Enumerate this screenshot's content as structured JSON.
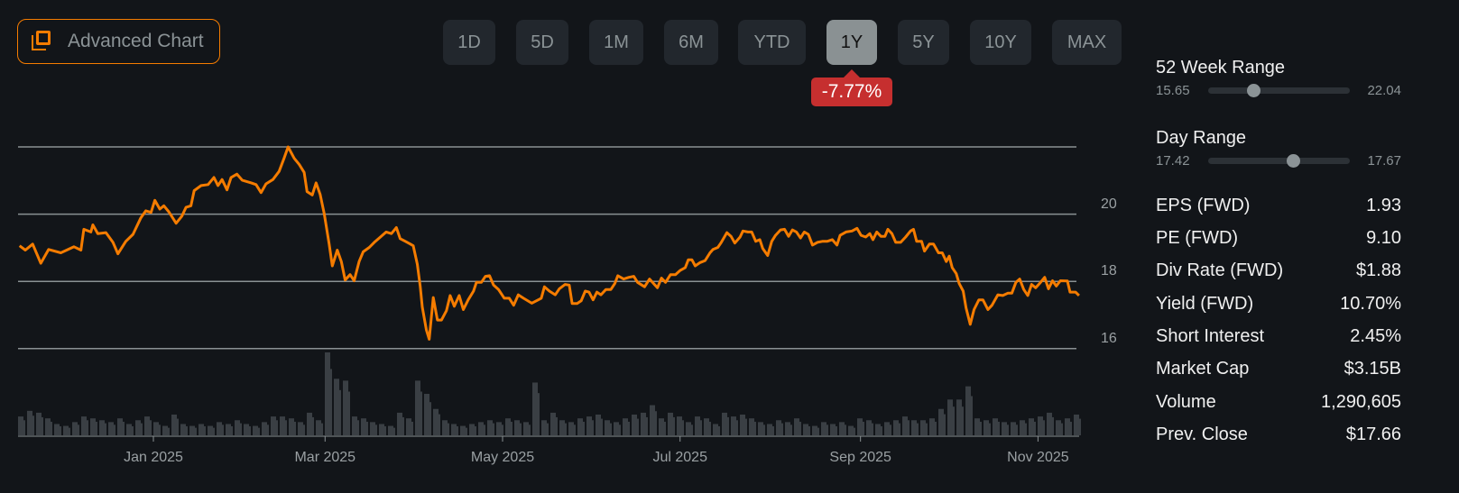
{
  "header": {
    "advanced_chart_label": "Advanced Chart"
  },
  "ranges": [
    {
      "label": "1D",
      "active": false
    },
    {
      "label": "5D",
      "active": false
    },
    {
      "label": "1M",
      "active": false
    },
    {
      "label": "6M",
      "active": false
    },
    {
      "label": "YTD",
      "active": false
    },
    {
      "label": "1Y",
      "active": true
    },
    {
      "label": "5Y",
      "active": false
    },
    {
      "label": "10Y",
      "active": false
    },
    {
      "label": "MAX",
      "active": false
    }
  ],
  "change_badge": "-7.77%",
  "colors": {
    "accent": "#f57c00",
    "negative": "#c62f2f",
    "volume": "#3a3f44",
    "grid": "#8a9193"
  },
  "week52": {
    "title": "52 Week Range",
    "low": "15.65",
    "high": "22.04",
    "position": 0.32
  },
  "day_range": {
    "title": "Day Range",
    "low": "17.42",
    "high": "17.67",
    "position": 0.6
  },
  "stats": [
    {
      "label": "EPS (FWD)",
      "value": "1.93"
    },
    {
      "label": "PE (FWD)",
      "value": "9.10"
    },
    {
      "label": "Div Rate (FWD)",
      "value": "$1.88"
    },
    {
      "label": "Yield (FWD)",
      "value": "10.70%"
    },
    {
      "label": "Short Interest",
      "value": "2.45%"
    },
    {
      "label": "Market Cap",
      "value": "$3.15B"
    },
    {
      "label": "Volume",
      "value": "1,290,605"
    },
    {
      "label": "Prev. Close",
      "value": "$17.66"
    }
  ],
  "chart_data": {
    "type": "line",
    "x_unit": "days since 2025-01-01",
    "y_ticks": [
      {
        "value": 20,
        "label": "20"
      },
      {
        "value": 18,
        "label": "18"
      },
      {
        "value": 16,
        "label": "16"
      }
    ],
    "y_gridlines": [
      16,
      18,
      20,
      22
    ],
    "ylim": [
      16,
      22
    ],
    "x_ticks": [
      {
        "day": 0,
        "label": "Jan 2025"
      },
      {
        "day": 59,
        "label": "Mar 2025"
      },
      {
        "day": 120,
        "label": "May 2025"
      },
      {
        "day": 181,
        "label": "Jul 2025"
      },
      {
        "day": 243,
        "label": "Sep 2025"
      },
      {
        "day": 304,
        "label": "Nov 2025"
      }
    ],
    "series": [
      {
        "name": "Price",
        "points": [
          [
            -46,
            19.06
          ],
          [
            -44,
            18.93
          ],
          [
            -41.5,
            19.11
          ],
          [
            -38.7,
            18.54
          ],
          [
            -36,
            18.95
          ],
          [
            -31.8,
            18.85
          ],
          [
            -27.3,
            19.03
          ],
          [
            -24.9,
            18.93
          ],
          [
            -23.9,
            19.55
          ],
          [
            -21.5,
            19.47
          ],
          [
            -20.8,
            19.68
          ],
          [
            -19.1,
            19.42
          ],
          [
            -16.3,
            19.45
          ],
          [
            -13.9,
            19.16
          ],
          [
            -12.2,
            18.82
          ],
          [
            -9.5,
            19.19
          ],
          [
            -7,
            19.4
          ],
          [
            -4.3,
            19.89
          ],
          [
            -2.6,
            20.1
          ],
          [
            -0.8,
            20.05
          ],
          [
            0.5,
            20.41
          ],
          [
            2.2,
            20.15
          ],
          [
            3.6,
            20.25
          ],
          [
            5.3,
            20.07
          ],
          [
            7.8,
            19.73
          ],
          [
            9.8,
            19.94
          ],
          [
            11.2,
            20.2
          ],
          [
            12.9,
            20.25
          ],
          [
            14,
            20.7
          ],
          [
            16.4,
            20.85
          ],
          [
            18.8,
            20.88
          ],
          [
            20.8,
            21.09
          ],
          [
            22.2,
            20.85
          ],
          [
            23.6,
            21.03
          ],
          [
            25.3,
            20.72
          ],
          [
            26.7,
            21.09
          ],
          [
            28.7,
            21.19
          ],
          [
            30.5,
            21.01
          ],
          [
            33.6,
            20.93
          ],
          [
            35.3,
            20.88
          ],
          [
            37,
            20.64
          ],
          [
            38.7,
            20.9
          ],
          [
            41.1,
            21.03
          ],
          [
            43.2,
            21.27
          ],
          [
            44.9,
            21.66
          ],
          [
            46.3,
            22.0
          ],
          [
            48.4,
            21.66
          ],
          [
            50.1,
            21.48
          ],
          [
            51.8,
            21.24
          ],
          [
            52.8,
            20.67
          ],
          [
            54.6,
            20.57
          ],
          [
            55.9,
            20.93
          ],
          [
            57.3,
            20.59
          ],
          [
            58.7,
            20.02
          ],
          [
            60.4,
            19.11
          ],
          [
            61.5,
            18.46
          ],
          [
            63.2,
            18.93
          ],
          [
            64.6,
            18.59
          ],
          [
            65.9,
            18.04
          ],
          [
            67.6,
            18.2
          ],
          [
            69,
            18.02
          ],
          [
            70.7,
            18.59
          ],
          [
            72.1,
            18.88
          ],
          [
            74.2,
            19.01
          ],
          [
            75.9,
            19.16
          ],
          [
            78,
            19.32
          ],
          [
            80,
            19.47
          ],
          [
            81.8,
            19.42
          ],
          [
            83.5,
            19.6
          ],
          [
            84.8,
            19.27
          ],
          [
            86.6,
            19.19
          ],
          [
            88.3,
            19.11
          ],
          [
            89.3,
            19.06
          ],
          [
            90.7,
            18.51
          ],
          [
            91.7,
            17.86
          ],
          [
            92.4,
            17.24
          ],
          [
            93.8,
            16.56
          ],
          [
            94.8,
            16.28
          ],
          [
            96.2,
            17.52
          ],
          [
            97.6,
            16.85
          ],
          [
            99,
            16.85
          ],
          [
            100.7,
            17.13
          ],
          [
            102,
            17.58
          ],
          [
            103.4,
            17.26
          ],
          [
            105.1,
            17.58
          ],
          [
            106.5,
            17.16
          ],
          [
            108.2,
            17.45
          ],
          [
            110,
            17.71
          ],
          [
            111,
            17.97
          ],
          [
            112.7,
            17.97
          ],
          [
            114.1,
            18.15
          ],
          [
            115.5,
            18.17
          ],
          [
            116.9,
            17.89
          ],
          [
            118.6,
            17.76
          ],
          [
            120.6,
            17.5
          ],
          [
            122.3,
            17.5
          ],
          [
            123.8,
            17.29
          ],
          [
            125.4,
            17.6
          ],
          [
            127.2,
            17.5
          ],
          [
            130,
            17.35
          ],
          [
            133.3,
            17.5
          ],
          [
            134.4,
            17.84
          ],
          [
            136.1,
            17.71
          ],
          [
            138.1,
            17.6
          ],
          [
            139.5,
            17.78
          ],
          [
            141.5,
            17.91
          ],
          [
            142.9,
            17.89
          ],
          [
            143.9,
            17.34
          ],
          [
            145.6,
            17.34
          ],
          [
            147,
            17.42
          ],
          [
            148.4,
            17.71
          ],
          [
            149.7,
            17.68
          ],
          [
            151.1,
            17.45
          ],
          [
            152.4,
            17.68
          ],
          [
            153.8,
            17.6
          ],
          [
            155.5,
            17.76
          ],
          [
            157.2,
            17.76
          ],
          [
            158.6,
            17.94
          ],
          [
            159.6,
            18.17
          ],
          [
            161.6,
            18.07
          ],
          [
            163.4,
            18.12
          ],
          [
            165.1,
            18.15
          ],
          [
            166.4,
            17.97
          ],
          [
            168.8,
            17.84
          ],
          [
            170.5,
            18.07
          ],
          [
            173.2,
            17.81
          ],
          [
            174.6,
            18.1
          ],
          [
            176,
            17.97
          ],
          [
            177.7,
            18.2
          ],
          [
            179.4,
            18.2
          ],
          [
            181.1,
            18.33
          ],
          [
            182.8,
            18.41
          ],
          [
            183.8,
            18.64
          ],
          [
            185.1,
            18.64
          ],
          [
            186.2,
            18.46
          ],
          [
            187.9,
            18.56
          ],
          [
            189.6,
            18.62
          ],
          [
            191.3,
            18.85
          ],
          [
            192.3,
            18.95
          ],
          [
            194,
            19.01
          ],
          [
            195,
            19.14
          ],
          [
            197.1,
            19.45
          ],
          [
            198.5,
            19.34
          ],
          [
            199.8,
            19.14
          ],
          [
            201.6,
            19.32
          ],
          [
            202.6,
            19.5
          ],
          [
            204.3,
            19.47
          ],
          [
            205.6,
            19.47
          ],
          [
            207,
            19.19
          ],
          [
            208.4,
            19.24
          ],
          [
            209.4,
            18.98
          ],
          [
            211.1,
            18.77
          ],
          [
            212.5,
            19.19
          ],
          [
            213.8,
            19.37
          ],
          [
            215.5,
            19.53
          ],
          [
            216.9,
            19.55
          ],
          [
            218.3,
            19.34
          ],
          [
            219.6,
            19.53
          ],
          [
            221,
            19.47
          ],
          [
            222.4,
            19.29
          ],
          [
            223.7,
            19.47
          ],
          [
            225.1,
            19.4
          ],
          [
            226.5,
            19.08
          ],
          [
            228.2,
            19.16
          ],
          [
            229.9,
            19.19
          ],
          [
            231.5,
            19.19
          ],
          [
            233.3,
            19.24
          ],
          [
            234.9,
            19.08
          ],
          [
            236,
            19.37
          ],
          [
            238,
            19.47
          ],
          [
            240.1,
            19.5
          ],
          [
            241.8,
            19.58
          ],
          [
            243.2,
            19.37
          ],
          [
            244.8,
            19.32
          ],
          [
            246.2,
            19.42
          ],
          [
            247.3,
            19.24
          ],
          [
            248.6,
            19.47
          ],
          [
            250,
            19.34
          ],
          [
            251.4,
            19.34
          ],
          [
            252.4,
            19.55
          ],
          [
            253.8,
            19.42
          ],
          [
            255.1,
            19.16
          ],
          [
            256.8,
            19.16
          ],
          [
            258.5,
            19.32
          ],
          [
            260.2,
            19.5
          ],
          [
            261.2,
            19.55
          ],
          [
            262.3,
            19.19
          ],
          [
            264,
            19.19
          ],
          [
            265,
            18.9
          ],
          [
            266.7,
            19.11
          ],
          [
            268.1,
            19.11
          ],
          [
            269.8,
            18.85
          ],
          [
            271.1,
            18.85
          ],
          [
            272.5,
            18.59
          ],
          [
            273.5,
            18.75
          ],
          [
            274.5,
            18.41
          ],
          [
            275.9,
            18.23
          ],
          [
            276.9,
            17.94
          ],
          [
            278.3,
            17.71
          ],
          [
            279.3,
            17.21
          ],
          [
            280.7,
            16.72
          ],
          [
            282,
            17.16
          ],
          [
            283.7,
            17.45
          ],
          [
            285.1,
            17.45
          ],
          [
            286.8,
            17.16
          ],
          [
            288.2,
            17.29
          ],
          [
            290.2,
            17.6
          ],
          [
            291.9,
            17.58
          ],
          [
            293.6,
            17.65
          ],
          [
            295,
            17.65
          ],
          [
            296.4,
            17.97
          ],
          [
            297.7,
            18.07
          ],
          [
            299.1,
            17.76
          ],
          [
            300.5,
            17.58
          ],
          [
            301.8,
            17.91
          ],
          [
            303.2,
            17.81
          ],
          [
            304.6,
            17.94
          ],
          [
            306.3,
            18.12
          ],
          [
            307.6,
            17.78
          ],
          [
            309,
            18.02
          ],
          [
            310.3,
            17.86
          ],
          [
            311.7,
            18.02
          ],
          [
            314.1,
            18.01
          ],
          [
            315,
            17.68
          ],
          [
            316.9,
            17.68
          ],
          [
            318.1,
            17.58
          ]
        ]
      }
    ],
    "volume": [
      1.0,
      1.3,
      1.2,
      0.9,
      0.6,
      0.5,
      0.7,
      1.0,
      0.9,
      0.8,
      0.7,
      0.9,
      0.6,
      0.8,
      1.0,
      0.7,
      0.5,
      1.1,
      0.6,
      0.5,
      0.6,
      0.5,
      0.7,
      0.6,
      0.8,
      0.6,
      0.5,
      0.7,
      1.0,
      1.0,
      0.9,
      0.7,
      1.2,
      0.8,
      4.4,
      3.0,
      2.9,
      1.0,
      0.9,
      0.7,
      0.6,
      0.5,
      1.2,
      0.9,
      2.9,
      2.2,
      1.4,
      0.8,
      0.6,
      0.5,
      0.6,
      0.7,
      0.8,
      0.7,
      0.9,
      0.8,
      0.7,
      2.8,
      0.8,
      1.2,
      0.8,
      0.7,
      0.9,
      1.0,
      1.1,
      0.8,
      0.7,
      0.9,
      1.1,
      1.2,
      1.6,
      0.9,
      1.2,
      1.0,
      0.7,
      1.0,
      0.9,
      0.6,
      1.2,
      1.0,
      1.1,
      0.9,
      0.7,
      0.6,
      0.8,
      0.7,
      0.9,
      0.6,
      0.5,
      0.7,
      0.6,
      0.7,
      0.5,
      0.9,
      0.8,
      0.6,
      0.7,
      0.8,
      1.0,
      0.8,
      0.8,
      0.9,
      1.4,
      1.9,
      1.9,
      2.6,
      0.9,
      0.8,
      0.9,
      0.7,
      0.7,
      0.8,
      0.9,
      1.0,
      1.2,
      0.8,
      0.9,
      1.1
    ]
  }
}
